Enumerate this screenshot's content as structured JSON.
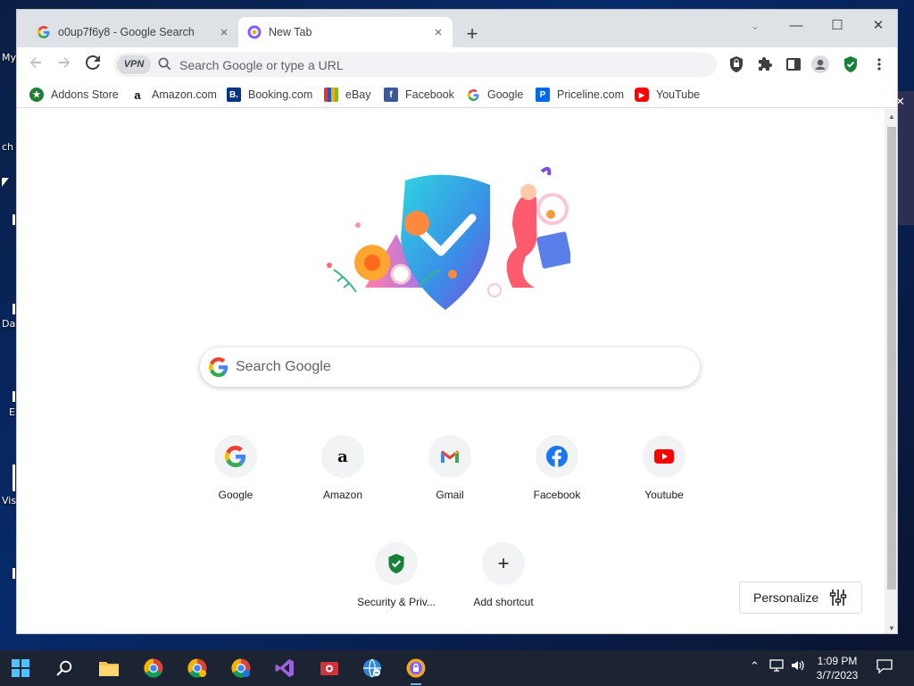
{
  "desktop": {
    "labels": [
      "My",
      "ch",
      "Da",
      "E",
      "Vis"
    ]
  },
  "browser": {
    "tabs": [
      {
        "title": "o0up7f6y8 - Google Search",
        "close": "×"
      },
      {
        "title": "New Tab",
        "close": "×"
      }
    ],
    "new_tab_symbol": "+",
    "window_controls": {
      "minimize": "—",
      "maximize": "☐",
      "close": "✕",
      "tab_search": "⌄"
    },
    "omnibox": {
      "vpn_label": "VPN",
      "placeholder": "Search Google or type a URL"
    },
    "bookmarks": [
      {
        "label": "Addons Store",
        "icon": "addons-store-icon"
      },
      {
        "label": "Amazon.com",
        "icon": "amazon-icon"
      },
      {
        "label": "Booking.com",
        "icon": "booking-icon"
      },
      {
        "label": "eBay",
        "icon": "ebay-icon"
      },
      {
        "label": "Facebook",
        "icon": "facebook-icon"
      },
      {
        "label": "Google",
        "icon": "google-icon"
      },
      {
        "label": "Priceline.com",
        "icon": "priceline-icon"
      },
      {
        "label": "YouTube",
        "icon": "youtube-icon"
      }
    ]
  },
  "newtab": {
    "search_placeholder": "Search Google",
    "shortcuts": [
      {
        "label": "Google"
      },
      {
        "label": "Amazon"
      },
      {
        "label": "Gmail"
      },
      {
        "label": "Facebook"
      },
      {
        "label": "Youtube"
      },
      {
        "label": "Security & Priv..."
      },
      {
        "label": "Add shortcut"
      }
    ],
    "personalize_label": "Personalize"
  },
  "taskbar": {
    "time": "1:09 PM",
    "date": "3/7/2023"
  },
  "colors": {
    "google_blue": "#4285F4",
    "google_red": "#EA4335",
    "google_yellow": "#FBBC05",
    "google_green": "#34A853",
    "facebook": "#1877F2",
    "youtube": "#FF0000",
    "security_green": "#188038"
  }
}
